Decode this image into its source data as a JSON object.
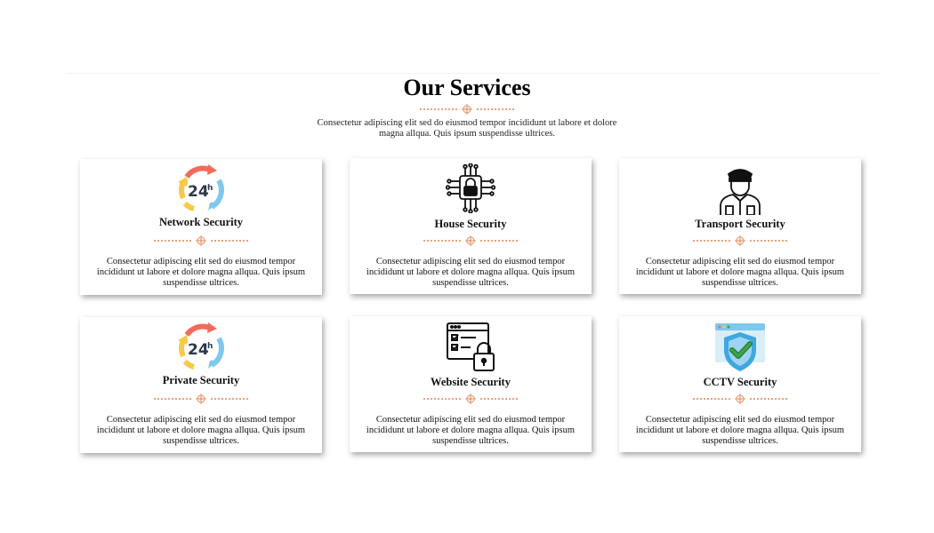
{
  "section": {
    "title": "Our Services",
    "subtitle": "Consectetur adipiscing elit sed do eiusmod tempor incididunt ut labore et dolore magna allqua. Quis ipsum suspendisse ultrices."
  },
  "icons": {
    "divider": "crosshair-icon",
    "network": "24h-support-icon",
    "house": "circuit-lock-icon",
    "transport": "security-guard-icon",
    "private": "24h-support-icon",
    "website": "website-lock-icon",
    "cctv": "shield-check-icon"
  },
  "colors": {
    "accent": "#e8a27a",
    "arrow_red": "#f26b5b",
    "arrow_yellow": "#f7c948",
    "arrow_blue": "#7ec8ee",
    "dark_text": "#2d3a4a",
    "shield_blue": "#3fa7e0",
    "check_green": "#3aa34a"
  },
  "services": [
    {
      "name": "Network Security",
      "description": "Consectetur adipiscing elit sed do eiusmod tempor incididunt ut labore et dolore magna allqua. Quis ipsum suspendisse ultrices."
    },
    {
      "name": "House Security",
      "description": "Consectetur adipiscing elit sed do eiusmod tempor incididunt ut labore et dolore magna allqua. Quis ipsum suspendisse ultrices."
    },
    {
      "name": "Transport Security",
      "description": "Consectetur adipiscing elit sed do eiusmod tempor incididunt ut labore et dolore magna allqua. Quis ipsum suspendisse ultrices."
    },
    {
      "name": "Private Security",
      "description": "Consectetur adipiscing elit sed do eiusmod tempor incididunt ut labore et dolore magna allqua. Quis ipsum suspendisse ultrices."
    },
    {
      "name": "Website Security",
      "description": "Consectetur adipiscing elit sed do eiusmod tempor incididunt ut labore et dolore magna allqua. Quis ipsum suspendisse ultrices."
    },
    {
      "name": "CCTV Security",
      "description": "Consectetur adipiscing elit sed do eiusmod tempor incididunt ut labore et dolore magna allqua. Quis ipsum suspendisse ultrices."
    }
  ]
}
